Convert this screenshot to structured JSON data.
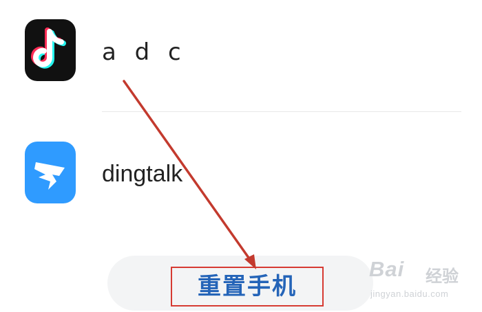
{
  "apps": [
    {
      "name": "a d c",
      "icon": "tiktok-icon",
      "icon_bg": "#111111"
    },
    {
      "name": "dingtalk",
      "icon": "dingtalk-icon",
      "icon_bg": "#2f9bff"
    }
  ],
  "reset_button": {
    "label": "重置手机",
    "label_color": "#2464b8",
    "highlight_color": "#d63a32"
  },
  "annotation": {
    "arrow_color": "#c33a2e"
  },
  "watermark": {
    "brand": "Bai",
    "suffix": "经验",
    "url": "jingyan.baidu.com"
  }
}
